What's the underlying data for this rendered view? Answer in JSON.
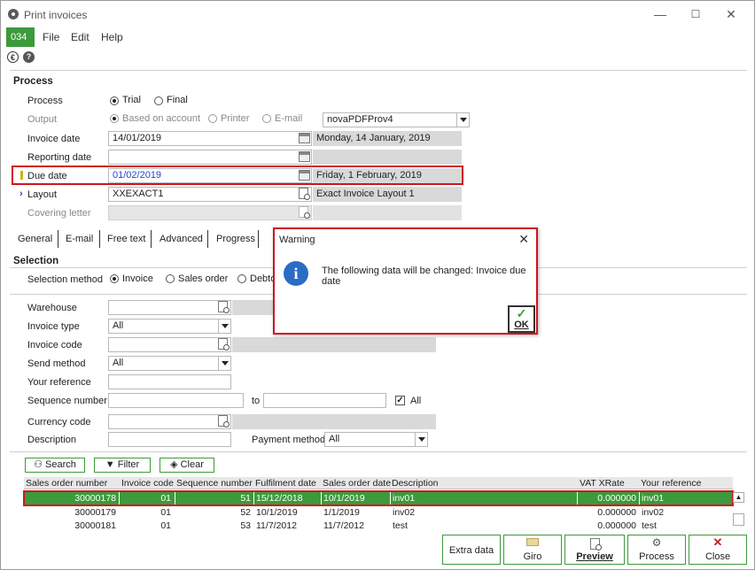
{
  "window": {
    "title": "Print invoices",
    "minimize": "—",
    "maximize": "☐",
    "close": "✕"
  },
  "company_badge": "034",
  "menu": {
    "file": "File",
    "edit": "Edit",
    "help": "Help"
  },
  "toolbar": {
    "euro": "€",
    "help": "?"
  },
  "process": {
    "section_title": "Process",
    "process_label": "Process",
    "trial_label": "Trial",
    "final_label": "Final",
    "output_label": "Output",
    "based_on_account_label": "Based on account",
    "printer_label": "Printer",
    "email_label": "E-mail",
    "printer_select_value": "novaPDFProv4",
    "invoice_date_label": "Invoice date",
    "invoice_date_value": "14/01/2019",
    "invoice_date_text": "Monday, 14 January, 2019",
    "reporting_date_label": "Reporting date",
    "reporting_date_value": "",
    "due_date_label": "Due date",
    "due_date_value": "01/02/2019",
    "due_date_text": "Friday, 1 February, 2019",
    "layout_label": "Layout",
    "layout_value": "XXEXACT1",
    "layout_text": "Exact Invoice Layout 1",
    "covering_letter_label": "Covering letter"
  },
  "tabs": [
    "General",
    "E-mail",
    "Free text",
    "Advanced",
    "Progress"
  ],
  "selection": {
    "section_title": "Selection",
    "method_label": "Selection method",
    "invoice_label": "Invoice",
    "sales_order_label": "Sales order",
    "debtor_label": "Debto",
    "warehouse_label": "Warehouse",
    "invoice_type_label": "Invoice type",
    "invoice_type_value": "All",
    "invoice_code_label": "Invoice code",
    "send_method_label": "Send method",
    "send_method_value": "All",
    "your_reference_label": "Your reference",
    "sequence_number_label": "Sequence number",
    "to_label": "to",
    "all_label": "All",
    "currency_code_label": "Currency code",
    "description_label": "Description",
    "payment_method_label": "Payment method",
    "payment_method_value": "All"
  },
  "actions": {
    "search": "Search",
    "filter": "Filter",
    "clear": "Clear"
  },
  "table": {
    "headers": [
      "Sales order number",
      "Invoice code",
      "Sequence number",
      "Fulfilment date",
      "Sales order date",
      "Description",
      "VAT XRate",
      "Your reference"
    ],
    "rows": [
      [
        "30000178",
        "01",
        "51",
        "15/12/2018",
        "10/1/2019",
        "inv01",
        "0.000000",
        "inv01"
      ],
      [
        "30000179",
        "01",
        "52",
        "10/1/2019",
        "1/1/2019",
        "inv02",
        "0.000000",
        "inv02"
      ],
      [
        "30000181",
        "01",
        "53",
        "11/7/2012",
        "11/7/2012",
        "test",
        "0.000000",
        "test"
      ]
    ]
  },
  "bottom_buttons": {
    "extra_data": "Extra data",
    "giro": "Giro",
    "preview": "Preview",
    "process": "Process",
    "close": "Close"
  },
  "dialog": {
    "title": "Warning",
    "message": "The following data will be changed: Invoice due date",
    "ok": "OK"
  },
  "colors": {
    "accent": "#3c9a3c",
    "highlight": "#d0141f",
    "info": "#2b6cc4"
  }
}
